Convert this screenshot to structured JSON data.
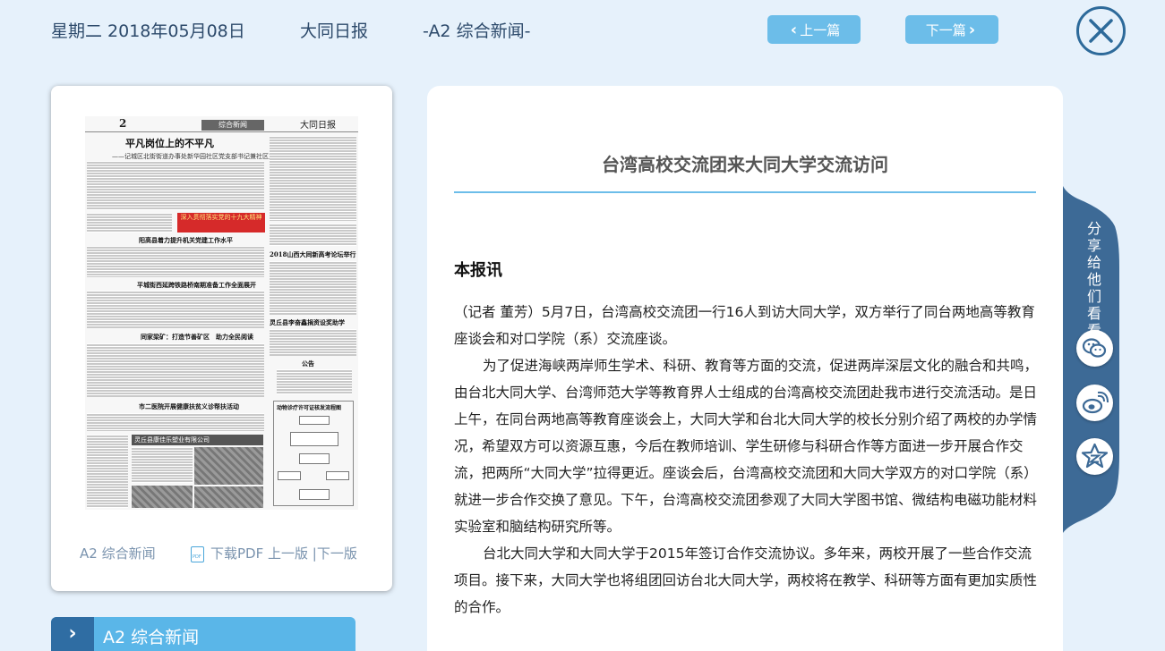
{
  "header": {
    "date": "星期二 2018年05月08日",
    "paper_name": "大同日报",
    "edition": "-A2 综合新闻-",
    "prev_label": "上一篇",
    "next_label": "下一篇"
  },
  "thumbnail": {
    "page_number": "2",
    "section_banner": "综合新闻",
    "masthead_logo": "大同日报",
    "headline": "平凡岗位上的不平凡",
    "subheadline": "——记城区北街街道办事处新华园社区党支部书记兼社区主任张文华",
    "red_banner": "深入贯彻落实党的十九大精神",
    "headings": [
      "阳高县着力提升机关党建工作水平",
      "平城街西延跨铁路桥南期准备工作全面展开",
      "同家梁矿：打造节善矿区　助力全民阅读",
      "市二医院开展健康扶贫义诊帮扶活动",
      "2018山西大同新高考论坛举行",
      "灵丘县李奋鑫捐资设奖助学",
      "公告",
      "动物诊疗许可证核发流程图"
    ],
    "ad_bar": "灵丘县康佳乐塑业有限公司",
    "footer_edition": "A2 综合新闻",
    "pdf_icon_text": "PDF",
    "download_label": "下载PDF",
    "prev_page_label": "上一版",
    "separator": " |",
    "next_page_label": "下一版"
  },
  "page_tab": {
    "label": "A2  综合新闻"
  },
  "article": {
    "title": "台湾高校交流团来大同大学交流访问",
    "lead": "本报讯",
    "paragraphs": [
      "（记者 董芳）5月7日，台湾高校交流团一行16人到访大同大学，双方举行了同台两地高等教育座谈会和对口学院（系）交流座谈。",
      "为了促进海峡两岸师生学术、科研、教育等方面的交流，促进两岸深层文化的融合和共鸣，由台北大同大学、台湾师范大学等教育界人士组成的台湾高校交流团赴我市进行交流活动。是日上午，在同台两地高等教育座谈会上，大同大学和台北大同大学的校长分别介绍了两校的办学情况，希望双方可以资源互惠，今后在教师培训、学生研修与科研合作等方面进一步开展合作交流，把两所“大同大学”拉得更近。座谈会后，台湾高校交流团和大同大学双方的对口学院（系）就进一步合作交换了意见。下午，台湾高校交流团参观了大同大学图书馆、微结构电磁功能材料实验室和脑结构研究所等。",
      "台北大同大学和大同大学于2015年签订合作交流协议。多年来，两校开展了一些合作交流项目。接下来，大同大学也将组团回访台北大同大学，两校将在教学、科研等方面有更加实质性的合作。"
    ]
  },
  "share": {
    "label": "分享给他们看看",
    "buttons": [
      "wechat-icon",
      "weibo-icon",
      "qzone-icon"
    ]
  },
  "colors": {
    "background": "#e6f1fb",
    "accent": "#6cbde9",
    "dark_blue": "#2f6da3",
    "share_tab": "#3d6a96"
  }
}
